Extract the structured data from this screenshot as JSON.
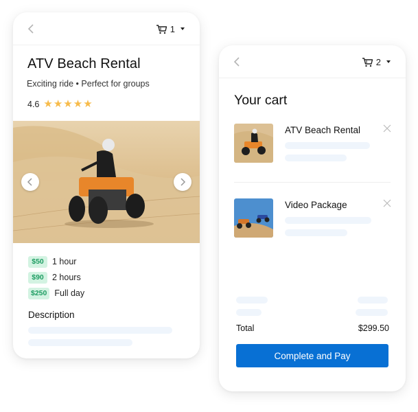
{
  "colors": {
    "accent": "#0870d4",
    "star": "#f7bb4a",
    "badge_bg": "#d3f3e2",
    "badge_text": "#1f9d63",
    "skeleton": "#eff5fc"
  },
  "product": {
    "header": {
      "back_icon": "chevron-left-icon",
      "cart_icon": "cart-icon",
      "cart_count": "1",
      "dropdown_icon": "caret-down-icon"
    },
    "title": "ATV Beach Rental",
    "subtitle": "Exciting ride • Perfect for groups",
    "rating": "4.6",
    "stars": 5,
    "image": {
      "description": "Rider on orange ATV in sand dunes",
      "prev_icon": "chevron-left-icon",
      "next_icon": "chevron-right-icon"
    },
    "prices": [
      {
        "price": "$50",
        "label": "1 hour"
      },
      {
        "price": "$90",
        "label": "2 hours"
      },
      {
        "price": "$250",
        "label": "Full day"
      }
    ],
    "description_title": "Description"
  },
  "cart": {
    "header": {
      "back_icon": "chevron-left-icon",
      "cart_icon": "cart-icon",
      "cart_count": "2",
      "dropdown_icon": "caret-down-icon"
    },
    "title": "Your cart",
    "items": [
      {
        "name": "ATV Beach Rental",
        "thumb": "Rider on orange ATV in dunes",
        "remove_icon": "close-icon"
      },
      {
        "name": "Video Package",
        "thumb": "Two ATVs jumping on dune",
        "remove_icon": "close-icon"
      }
    ],
    "total_label": "Total",
    "total_value": "$299.50",
    "pay_button": "Complete and Pay"
  }
}
